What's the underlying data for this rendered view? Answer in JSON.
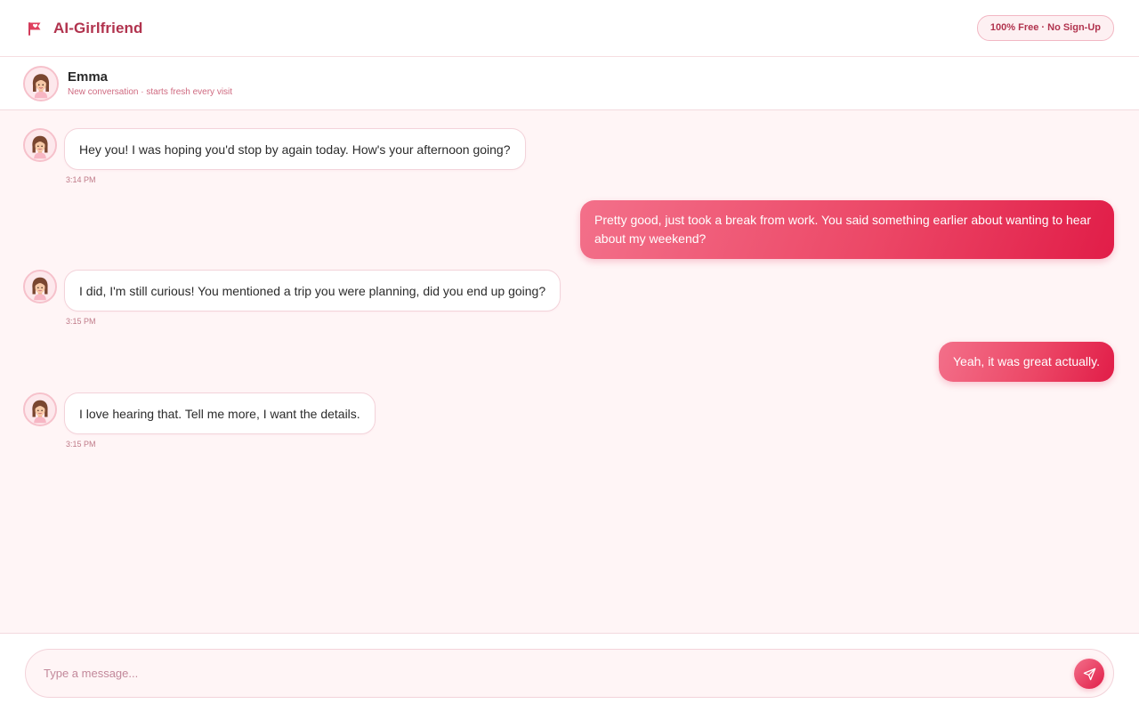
{
  "header": {
    "brand_name": "AI-Girlfriend",
    "brand_icon": "flag-heart-icon",
    "badge": "100% Free · No Sign-Up"
  },
  "contact": {
    "name": "Emma",
    "subtitle": "New conversation · starts fresh every visit",
    "avatar_icon": "girl-avatar-icon"
  },
  "messages": [
    {
      "sender": "ai",
      "text": "Hey you! I was hoping you'd stop by again today. How's your afternoon going?",
      "time": "3:14 PM"
    },
    {
      "sender": "user",
      "text": "Pretty good, just took a break from work. You said something earlier about wanting to hear about my weekend?"
    },
    {
      "sender": "ai",
      "text": "I did, I'm still curious! You mentioned a trip you were planning, did you end up going?",
      "time": "3:15 PM"
    },
    {
      "sender": "user",
      "text": "Yeah, it was great actually."
    },
    {
      "sender": "ai",
      "text": "I love hearing that. Tell me more, I want the details.",
      "time": "3:15 PM"
    }
  ],
  "composer": {
    "placeholder": "Type a message...",
    "value": "",
    "send_icon": "send-icon"
  },
  "colors": {
    "accent": "#e11d48",
    "accent_light": "#f3708a",
    "brand_text": "#b1334e",
    "chat_background": "#fff5f6"
  }
}
